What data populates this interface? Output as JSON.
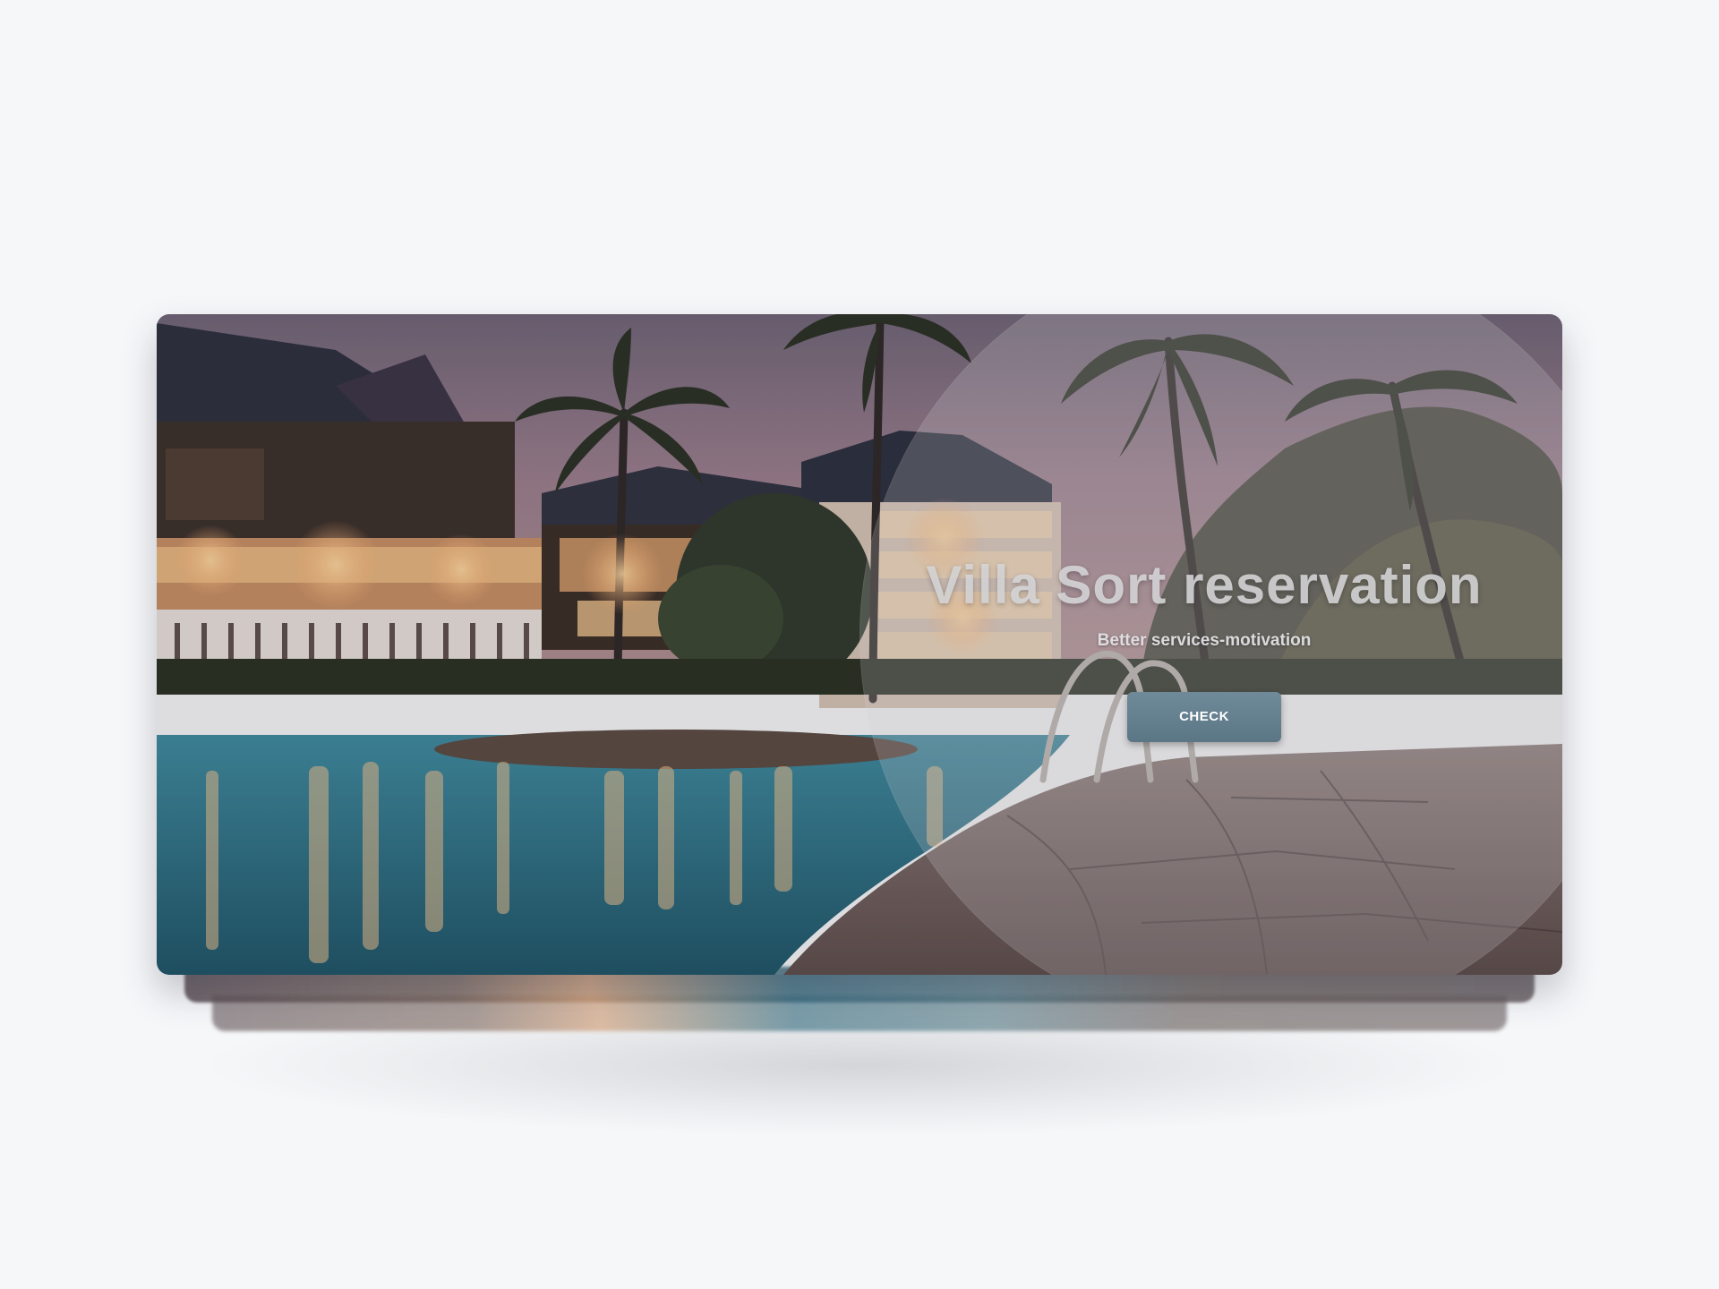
{
  "hero": {
    "title": "Villa Sort reservation",
    "subtitle": "Better services-motivation",
    "button_label": "CHECK"
  },
  "colors": {
    "page_background": "#f6f7f9",
    "button_background": "#627d8c",
    "title_text": "#d7d7da",
    "water": "#2c6e83",
    "sky": "#8c7486"
  }
}
